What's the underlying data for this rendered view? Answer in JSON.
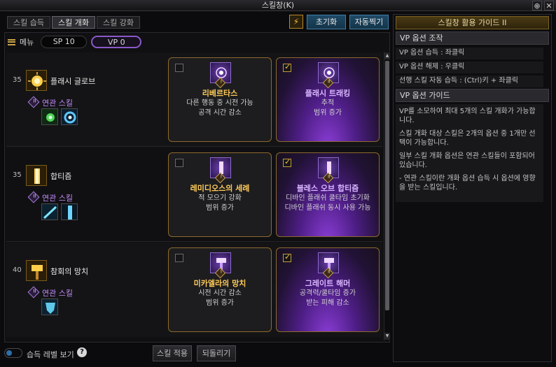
{
  "window": {
    "title": "스킬창(K)",
    "pin_glyph": "⊕",
    "close_glyph": "✕"
  },
  "tabs": [
    {
      "label": "스킬 습득",
      "active": false
    },
    {
      "label": "스킬 개화",
      "active": true
    },
    {
      "label": "스킬 강화",
      "active": false
    }
  ],
  "toolbar": {
    "reset_label": "초기화",
    "auto_label": "자동찍기"
  },
  "menu": {
    "label": "메뉴",
    "sp": "SP 10",
    "vp": "VP 0"
  },
  "skills": [
    {
      "level": "35",
      "name": "플래시 글로브",
      "related_label": "연관 스킬",
      "related_tier": "II",
      "options": [
        {
          "tier": "I",
          "title": "리베르타스",
          "desc1": "다른 행동 중 시전 가능",
          "desc2": "공격 시간 감소",
          "checked": false
        },
        {
          "tier": "II",
          "title": "플래시 트래킹",
          "desc1": "추적",
          "desc2": "범위 증가",
          "checked": true
        }
      ]
    },
    {
      "level": "35",
      "name": "합티즘",
      "related_label": "연관 스킬",
      "related_tier": "II",
      "options": [
        {
          "tier": "I",
          "title": "레미디오스의 세례",
          "desc1": "적 모으기 강화",
          "desc2": "범위 증가",
          "checked": false
        },
        {
          "tier": "II",
          "title": "블레스 오브 합티즘",
          "desc1": "디바인 플래쉬 쿨타임 초기화",
          "desc2": "디바인 플래쉬 동시 사용 가능",
          "checked": true
        }
      ]
    },
    {
      "level": "40",
      "name": "참회의 망치",
      "related_label": "연관 스킬",
      "related_tier": "II",
      "options": [
        {
          "tier": "I",
          "title": "미카엘라의 망치",
          "desc1": "시전 시간 감소",
          "desc2": "범위 증가",
          "checked": false
        },
        {
          "tier": "II",
          "title": "그레이트 해머",
          "desc1": "공격력/쿨타임 증가",
          "desc2": "받는 피해 감소",
          "checked": true
        }
      ]
    }
  ],
  "bottom": {
    "toggle_label": "습득 레벨 보기",
    "help": "?",
    "apply_label": "스킬 적용",
    "revert_label": "되돌리기"
  },
  "guide": {
    "title": "스킬창 활용 가이드 II",
    "section1_title": "VP 옵션 조작",
    "items": [
      "VP 옵션 습득 : 좌클릭",
      "VP 옵션 해제 : 우클릭",
      "선행 스킬 자동 습득 : (Ctrl)키 + 좌클릭"
    ],
    "section2_title": "VP 옵션 가이드",
    "body": [
      "VP를 소모하여 최대 5개의 스킬 개화가 가능합니다.",
      "스킬 개화 대상 스킬은 2개의 옵션 중 1개만 선택이 가능합니다.",
      "일부 스킬 개화 옵션은 연관 스킬들이 포함되어 있습니다.",
      "- 연관 스킬이란 개화 옵션 습득 시 옵션에 영향을 받는 스킬입니다."
    ]
  }
}
